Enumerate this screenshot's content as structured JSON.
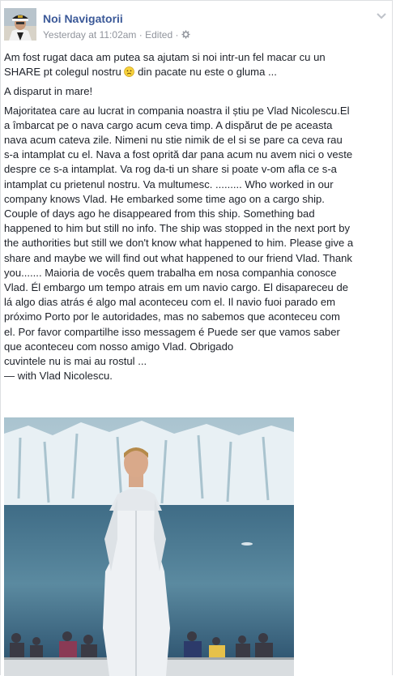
{
  "post": {
    "page_name": "Noi Navigatorii",
    "timestamp": "Yesterday at 11:02am",
    "separator": "·",
    "edited": "Edited",
    "intro_before_emoji": "Am fost rugat daca am putea sa ajutam si noi intr-un fel macar cu un",
    "intro_line2_start": "SHARE pt colegul nostru",
    "intro_line2_end": "din pacate nu este o gluma ...",
    "heading": "A disparut in mare!",
    "body_lines": [
      "Majoritatea care au lucrat in compania noastra il știu pe Vlad Nicolescu.El",
      "a îmbarcat pe o nava cargo acum ceva timp. A dispărut de pe aceasta",
      "nava acum cateva zile. Nimeni nu stie nimik de el si se pare ca ceva rau",
      "s-a intamplat cu el. Nava a fost oprită dar pana acum nu avem nici o veste",
      "despre ce s-a intamplat. Va rog da-ti un share si poate v-om afla ce s-a",
      "intamplat cu prietenul nostru. Va multumesc. ......... Who worked in our",
      "company knows Vlad. He embarked some time ago on a cargo ship.",
      "Couple of days ago he disappeared from this ship. Something bad",
      "happened to him but still no info. The ship was stopped in the next port by",
      "the authorities but still we don't know what happened to him. Please give a",
      "share and maybe we will find out what happened to our friend Vlad. Thank",
      "you....... Maioria de vocês quem trabalha em nosa companhia conosce",
      "Vlad. Él embargo um tempo atrais em um navio cargo. El disapareceu de",
      "lá algo dias atrás é algo mal aconteceu com el. Il navio fuoi parado em",
      "próximo Porto por le autoridades, mas no sabemos que aconteceu com",
      "el. Por favor compartilhe isso messagem é Puede ser que vamos saber",
      "que aconteceu com nosso amigo Vlad. Obrigado",
      "cuvintele nu is mai au rostul ..."
    ],
    "tag_prefix": "— with",
    "tagged_name": "Vlad Nicolescu",
    "tag_suffix": "."
  },
  "icons": {
    "settings": "gear-icon",
    "menu": "chevron-down-icon",
    "emoji": "sad-face-emoji-icon"
  },
  "colors": {
    "link": "#3b5998",
    "meta": "#90949c",
    "text": "#1d2129"
  }
}
